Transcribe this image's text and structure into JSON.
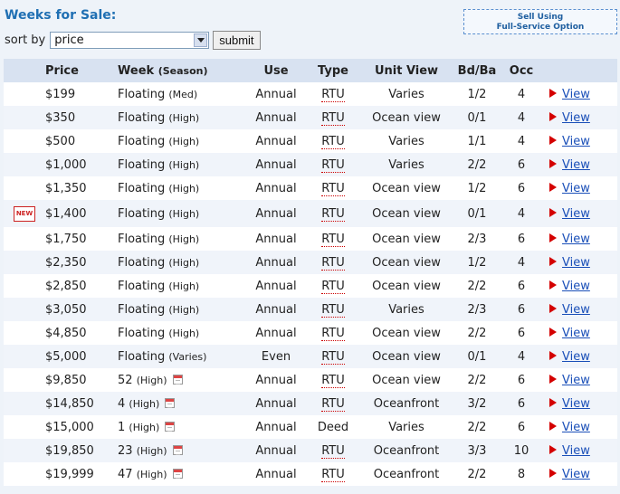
{
  "page": {
    "title": "Weeks for Sale:",
    "sort_label": "sort by",
    "sort_value": "price",
    "submit_label": "submit",
    "sell_line1": "Sell Using",
    "sell_line2": "Full-Service Option"
  },
  "table": {
    "headers": {
      "price": "Price",
      "week": "Week",
      "season": "(Season)",
      "use": "Use",
      "type": "Type",
      "unit_view": "Unit View",
      "bdba": "Bd/Ba",
      "occ": "Occ"
    },
    "new_badge": "NEW",
    "view_label": "View",
    "rows": [
      {
        "price": "$199",
        "week": "Floating",
        "season": "(Med)",
        "use": "Annual",
        "type": "RTU",
        "view": "Varies",
        "bdba": "1/2",
        "occ": "4"
      },
      {
        "price": "$350",
        "week": "Floating",
        "season": "(High)",
        "use": "Annual",
        "type": "RTU",
        "view": "Ocean view",
        "bdba": "0/1",
        "occ": "4"
      },
      {
        "price": "$500",
        "week": "Floating",
        "season": "(High)",
        "use": "Annual",
        "type": "RTU",
        "view": "Varies",
        "bdba": "1/1",
        "occ": "4"
      },
      {
        "price": "$1,000",
        "week": "Floating",
        "season": "(High)",
        "use": "Annual",
        "type": "RTU",
        "view": "Varies",
        "bdba": "2/2",
        "occ": "6"
      },
      {
        "price": "$1,350",
        "week": "Floating",
        "season": "(High)",
        "use": "Annual",
        "type": "RTU",
        "view": "Ocean view",
        "bdba": "1/2",
        "occ": "6"
      },
      {
        "price": "$1,400",
        "week": "Floating",
        "season": "(High)",
        "use": "Annual",
        "type": "RTU",
        "view": "Ocean view",
        "bdba": "0/1",
        "occ": "4",
        "is_new": true
      },
      {
        "price": "$1,750",
        "week": "Floating",
        "season": "(High)",
        "use": "Annual",
        "type": "RTU",
        "view": "Ocean view",
        "bdba": "2/3",
        "occ": "6"
      },
      {
        "price": "$2,350",
        "week": "Floating",
        "season": "(High)",
        "use": "Annual",
        "type": "RTU",
        "view": "Ocean view",
        "bdba": "1/2",
        "occ": "4"
      },
      {
        "price": "$2,850",
        "week": "Floating",
        "season": "(High)",
        "use": "Annual",
        "type": "RTU",
        "view": "Ocean view",
        "bdba": "2/2",
        "occ": "6"
      },
      {
        "price": "$3,050",
        "week": "Floating",
        "season": "(High)",
        "use": "Annual",
        "type": "RTU",
        "view": "Varies",
        "bdba": "2/3",
        "occ": "6"
      },
      {
        "price": "$4,850",
        "week": "Floating",
        "season": "(High)",
        "use": "Annual",
        "type": "RTU",
        "view": "Ocean view",
        "bdba": "2/2",
        "occ": "6"
      },
      {
        "price": "$5,000",
        "week": "Floating",
        "season": "(Varies)",
        "use": "Even",
        "type": "RTU",
        "view": "Ocean view",
        "bdba": "0/1",
        "occ": "4"
      },
      {
        "price": "$9,850",
        "week": "52",
        "season": "(High)",
        "use": "Annual",
        "type": "RTU",
        "view": "Ocean view",
        "bdba": "2/2",
        "occ": "6",
        "calendar": true
      },
      {
        "price": "$14,850",
        "week": "4",
        "season": "(High)",
        "use": "Annual",
        "type": "RTU",
        "view": "Oceanfront",
        "bdba": "3/2",
        "occ": "6",
        "calendar": true
      },
      {
        "price": "$15,000",
        "week": "1",
        "season": "(High)",
        "use": "Annual",
        "type": "Deed",
        "view": "Varies",
        "bdba": "2/2",
        "occ": "6",
        "calendar": true
      },
      {
        "price": "$19,850",
        "week": "23",
        "season": "(High)",
        "use": "Annual",
        "type": "RTU",
        "view": "Oceanfront",
        "bdba": "3/3",
        "occ": "10",
        "calendar": true
      },
      {
        "price": "$19,999",
        "week": "47",
        "season": "(High)",
        "use": "Annual",
        "type": "RTU",
        "view": "Oceanfront",
        "bdba": "2/2",
        "occ": "8",
        "calendar": true
      }
    ]
  }
}
